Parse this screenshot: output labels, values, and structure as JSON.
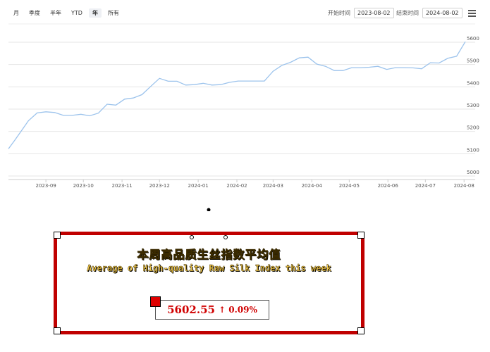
{
  "toolbar": {
    "ranges": [
      "月",
      "季度",
      "半年",
      "YTD",
      "年",
      "所有"
    ],
    "active_range": "年",
    "start_label": "开始时间",
    "start_date": "2023-08-02",
    "end_label": "结束时间",
    "end_date": "2024-08-02",
    "menu_icon": "hamburger-menu-icon"
  },
  "chart_data": {
    "type": "line",
    "series": [
      {
        "color": "#9cc3ec",
        "values": [
          [
            "2023-08-02",
            5122
          ],
          [
            "2023-08-07",
            5160
          ],
          [
            "2023-08-12",
            5200
          ],
          [
            "2023-08-18",
            5248
          ],
          [
            "2023-08-25",
            5283
          ],
          [
            "2023-09-01",
            5288
          ],
          [
            "2023-09-08",
            5285
          ],
          [
            "2023-09-15",
            5272
          ],
          [
            "2023-09-22",
            5272
          ],
          [
            "2023-09-29",
            5277
          ],
          [
            "2023-10-06",
            5270
          ],
          [
            "2023-10-13",
            5282
          ],
          [
            "2023-10-20",
            5322
          ],
          [
            "2023-10-27",
            5318
          ],
          [
            "2023-11-03",
            5345
          ],
          [
            "2023-11-10",
            5350
          ],
          [
            "2023-11-17",
            5365
          ],
          [
            "2023-11-24",
            5402
          ],
          [
            "2023-12-01",
            5438
          ],
          [
            "2023-12-08",
            5425
          ],
          [
            "2023-12-15",
            5425
          ],
          [
            "2023-12-22",
            5408
          ],
          [
            "2023-12-29",
            5410
          ],
          [
            "2024-01-05",
            5416
          ],
          [
            "2024-01-12",
            5408
          ],
          [
            "2024-01-19",
            5410
          ],
          [
            "2024-01-26",
            5420
          ],
          [
            "2024-02-02",
            5426
          ],
          [
            "2024-02-09",
            5426
          ],
          [
            "2024-02-23",
            5426
          ],
          [
            "2024-03-01",
            5470
          ],
          [
            "2024-03-08",
            5496
          ],
          [
            "2024-03-15",
            5510
          ],
          [
            "2024-03-22",
            5530
          ],
          [
            "2024-03-29",
            5533
          ],
          [
            "2024-04-05",
            5502
          ],
          [
            "2024-04-12",
            5492
          ],
          [
            "2024-04-19",
            5473
          ],
          [
            "2024-04-26",
            5473
          ],
          [
            "2024-05-03",
            5486
          ],
          [
            "2024-05-10",
            5486
          ],
          [
            "2024-05-17",
            5488
          ],
          [
            "2024-05-24",
            5492
          ],
          [
            "2024-05-31",
            5478
          ],
          [
            "2024-06-07",
            5486
          ],
          [
            "2024-06-14",
            5486
          ],
          [
            "2024-06-21",
            5485
          ],
          [
            "2024-06-28",
            5481
          ],
          [
            "2024-07-05",
            5508
          ],
          [
            "2024-07-12",
            5507
          ],
          [
            "2024-07-19",
            5528
          ],
          [
            "2024-07-26",
            5537
          ],
          [
            "2024-08-02",
            5602.55
          ]
        ]
      }
    ],
    "x_ticks": [
      "2023-09",
      "2023-10",
      "2023-11",
      "2023-12",
      "2024-01",
      "2024-02",
      "2024-03",
      "2024-04",
      "2024-05",
      "2024-06",
      "2024-07",
      "2024-08"
    ],
    "y_ticks": [
      5000,
      5100,
      5200,
      5300,
      5400,
      5500,
      5600
    ],
    "ylim": [
      5000,
      5600
    ],
    "xlim": [
      "2023-08-02",
      "2024-08-02"
    ],
    "grid": true,
    "y_axis_side": "right"
  },
  "callout": {
    "title_cn": "本周高品质生丝指数平均值",
    "title_en": "Average of High-quality Raw Silk Index this week",
    "value": "5602.55",
    "change": "↑ 0.09%",
    "border_color": "#c00000",
    "text_color": "#f2c94c"
  }
}
